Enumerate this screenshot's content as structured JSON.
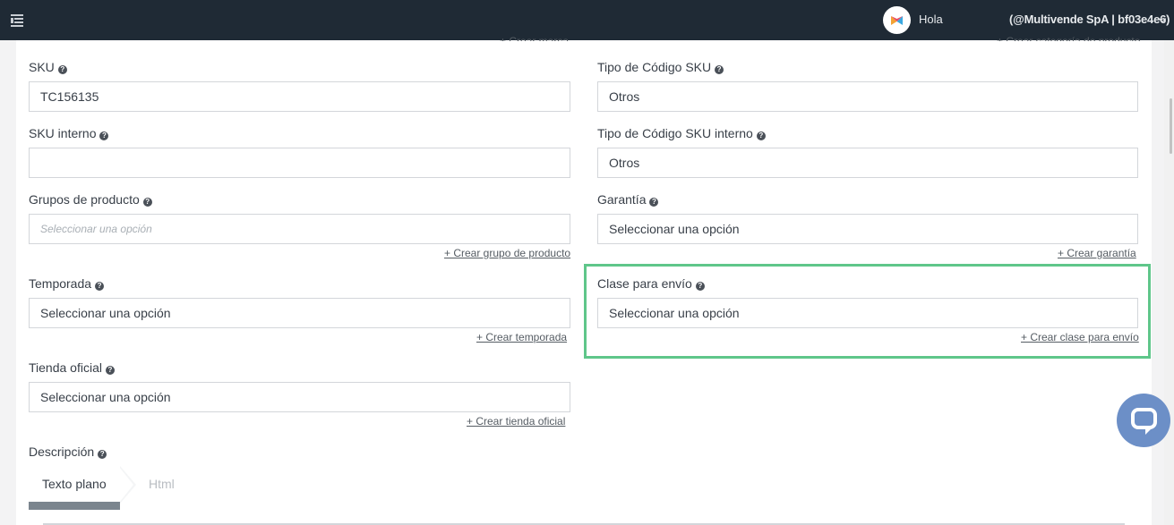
{
  "topbar": {
    "greeting": "Hola",
    "account": "(@Multivende SpA | bf03e4e6)"
  },
  "partial_links": {
    "left": "+ Crear marca",
    "right": "+ Crear categoría de producto"
  },
  "help_glyph": "?",
  "form": {
    "sku": {
      "label": "SKU",
      "value": "TC156135"
    },
    "sku_code_type": {
      "label": "Tipo de Código SKU",
      "value": "Otros"
    },
    "sku_internal": {
      "label": "SKU interno",
      "value": ""
    },
    "sku_internal_code_type": {
      "label": "Tipo de Código SKU interno",
      "value": "Otros"
    },
    "product_groups": {
      "label": "Grupos de producto",
      "placeholder": "Seleccionar una opción",
      "create_link": "+ Crear grupo de producto"
    },
    "warranty": {
      "label": "Garantía",
      "value": "Seleccionar una opción",
      "create_link": "+ Crear garantía"
    },
    "season": {
      "label": "Temporada",
      "value": "Seleccionar una opción",
      "create_link": "+ Crear temporada"
    },
    "shipping_class": {
      "label": "Clase para envío",
      "value": "Seleccionar una opción",
      "create_link": "+ Crear clase para envío"
    },
    "official_store": {
      "label": "Tienda oficial",
      "value": "Seleccionar una opción",
      "create_link": "+ Crear tienda oficial"
    },
    "description": {
      "label": "Descripción",
      "tabs": [
        "Texto plano",
        "Html"
      ],
      "active_tab": "Texto plano"
    }
  },
  "colors": {
    "topbar": "#1f2a35",
    "highlight": "#5fc68a",
    "chat": "#6c8fc7"
  }
}
